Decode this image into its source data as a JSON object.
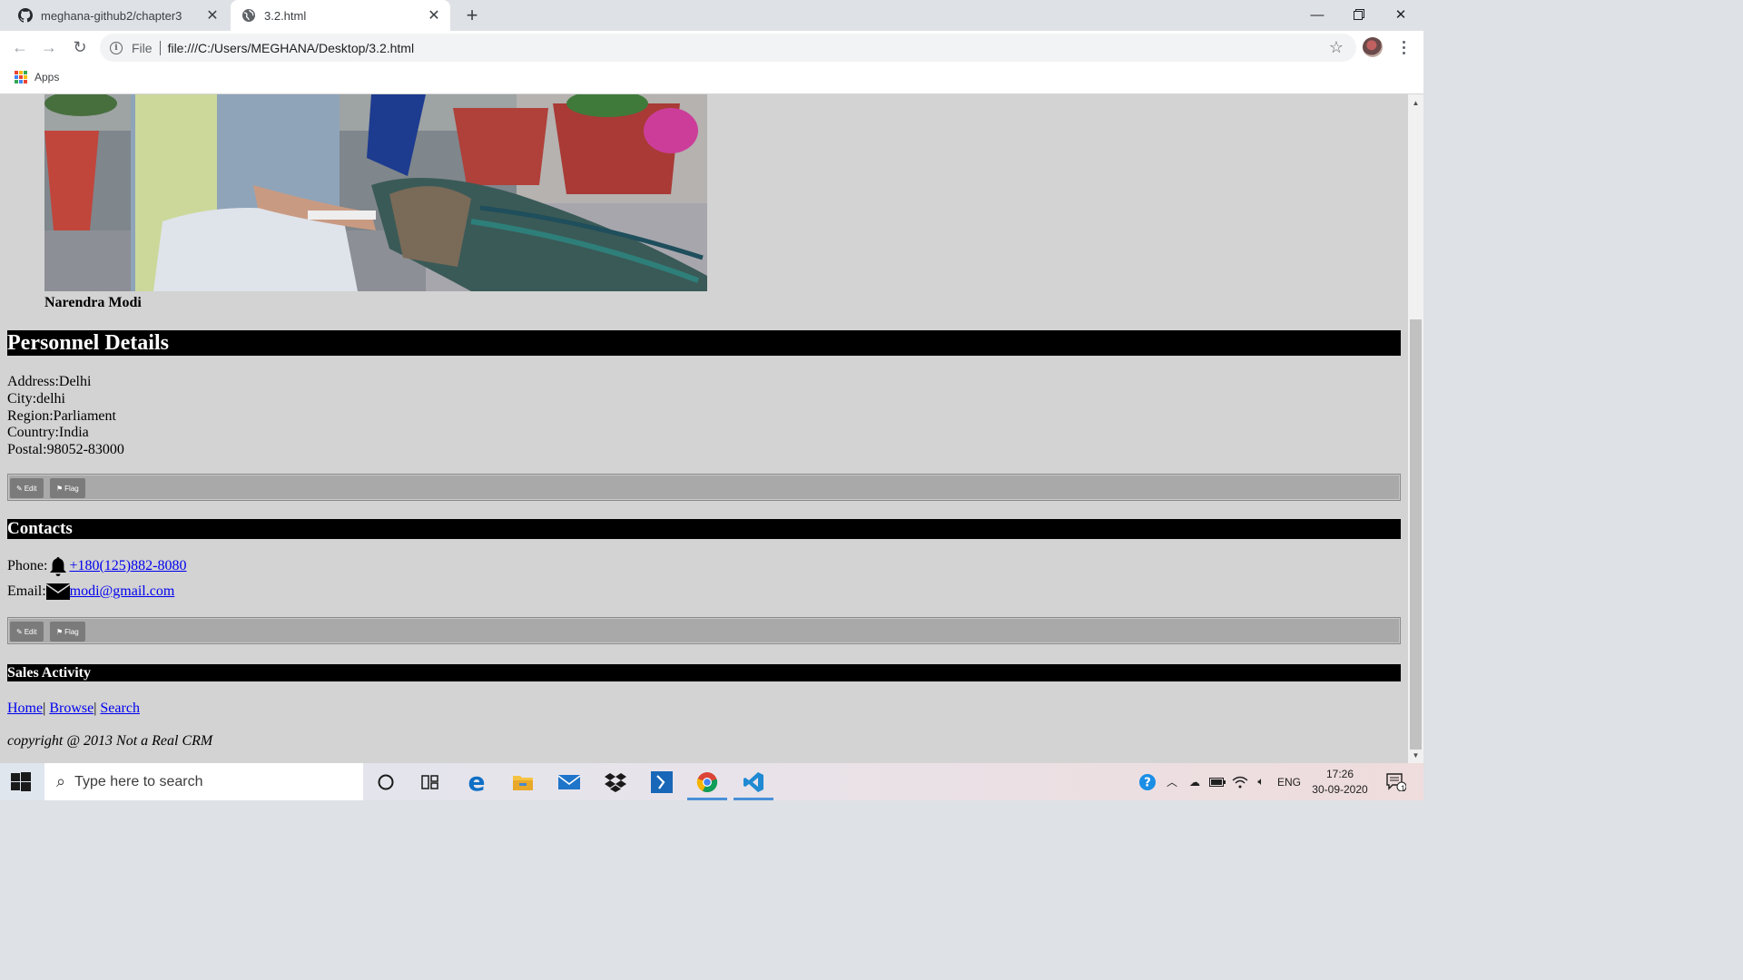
{
  "browser": {
    "tabs": [
      {
        "title": "meghana-github2/chapter3",
        "icon": "github-icon",
        "active": false
      },
      {
        "title": "3.2.html",
        "icon": "globe-icon",
        "active": true
      }
    ],
    "new_tab_label": "+",
    "address": {
      "scheme": "File",
      "url": "file:///C:/Users/MEGHANA/Desktop/3.2.html"
    },
    "bookmarks": [
      {
        "label": "Apps",
        "icon": "apps-grid-icon"
      }
    ]
  },
  "page": {
    "photo_caption": "Narendra Modi",
    "personnel": {
      "heading": "Personnel Details",
      "lines": [
        "Address:Delhi",
        "City:delhi",
        "Region:Parliament",
        "Country:India",
        "Postal:98052-83000"
      ]
    },
    "actions": {
      "edit_label": "Edit",
      "flag_label": "Flag"
    },
    "contacts": {
      "heading": "Contacts",
      "phone_label": "Phone:",
      "phone_value": "+180(125)882-8080",
      "email_label": "Email:",
      "email_value": "modi@gmail.com"
    },
    "sales": {
      "heading": "Sales Activity"
    },
    "nav_links": [
      "Home",
      "Browse",
      "Search"
    ],
    "nav_separator": "|",
    "copyright": "copyright @ 2013 Not a Real CRM"
  },
  "taskbar": {
    "search_placeholder": "Type here to search",
    "pinned": [
      "cortana-icon",
      "task-view-icon",
      "edge-icon",
      "file-explorer-icon",
      "mail-icon",
      "dropbox-icon",
      "powershell-icon",
      "chrome-icon",
      "vscode-icon"
    ],
    "active_app": "chrome-icon",
    "tray": {
      "language": "ENG",
      "time": "17:26",
      "date": "30-09-2020",
      "notification_count": "1"
    }
  },
  "colors": {
    "page_background": "#d3d3d3",
    "heading_bar": "#000000",
    "action_bar": "#a9a9a9",
    "link": "#0000ee"
  }
}
